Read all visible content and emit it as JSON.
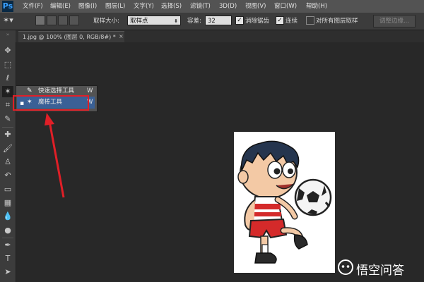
{
  "app": {
    "logo_text": "Ps"
  },
  "menubar": {
    "items": [
      "文件(F)",
      "编辑(E)",
      "图像(I)",
      "图层(L)",
      "文字(Y)",
      "选择(S)",
      "滤镜(T)",
      "3D(D)",
      "视图(V)",
      "窗口(W)",
      "帮助(H)"
    ]
  },
  "options": {
    "sample_size_label": "取样大小:",
    "sample_size_value": "取样点",
    "tolerance_label": "容差:",
    "tolerance_value": "32",
    "antialias_label": "消除锯齿",
    "antialias_checked": true,
    "contiguous_label": "连续",
    "contiguous_checked": true,
    "all_layers_label": "对所有图层取样",
    "all_layers_checked": false,
    "refine_edge_label": "调整边缘..."
  },
  "document": {
    "tab_title": "1.jpg @ 100% (图层 0, RGB/8#) *",
    "close_glyph": "×"
  },
  "flyout": {
    "items": [
      {
        "label": "快速选择工具",
        "shortcut": "W",
        "icon": "quick-selection-icon",
        "selected": false
      },
      {
        "label": "魔棒工具",
        "shortcut": "W",
        "icon": "magic-wand-icon",
        "selected": true
      }
    ]
  },
  "annotation": {
    "color": "#e01f27"
  },
  "watermark": {
    "text": "悟空问答"
  }
}
